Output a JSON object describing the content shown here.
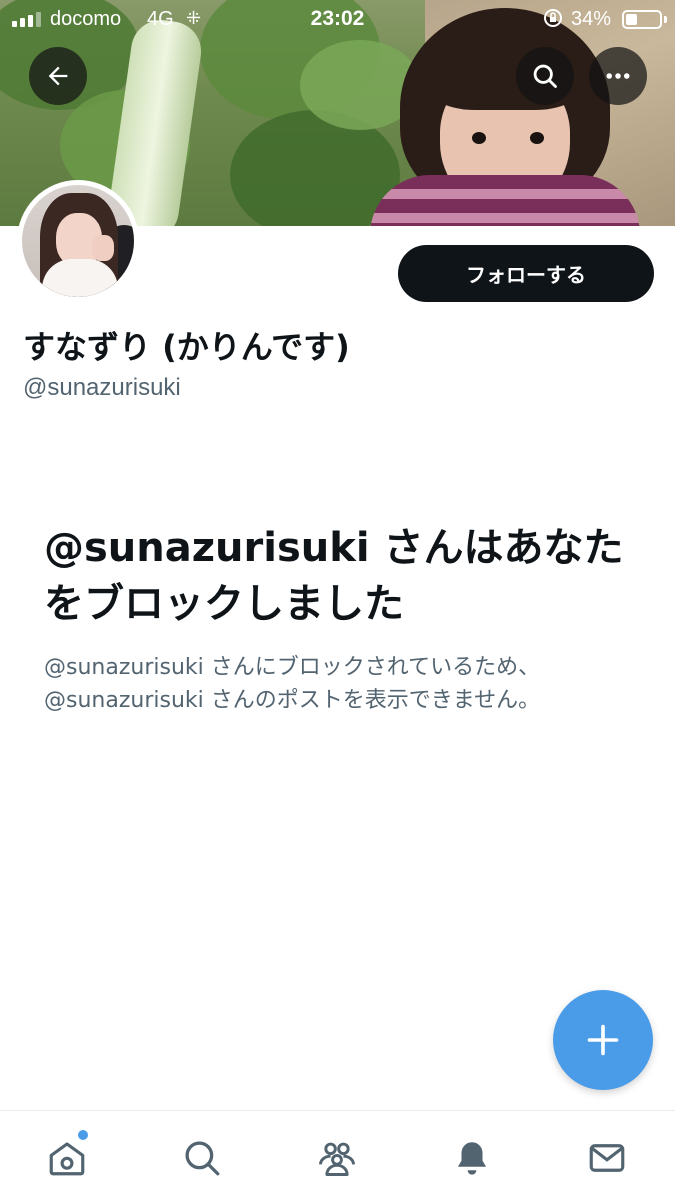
{
  "status_bar": {
    "carrier": "docomo",
    "network": "4G",
    "time": "23:02",
    "battery_percent": "34%",
    "battery_level": 0.34
  },
  "header": {
    "back_icon": "back-arrow-icon",
    "search_icon": "search-icon",
    "more_icon": "more-icon"
  },
  "profile": {
    "display_name": "すなずり (かりんです)",
    "handle": "@sunazurisuki",
    "follow_label": "フォローする"
  },
  "blocked": {
    "title": "@sunazurisuki さんはあなたをブロックしました",
    "description_line1": "@sunazurisuki さんにブロックされているため、",
    "description_line2": "@sunazurisuki さんのポストを表示できません。"
  },
  "fab": {
    "icon": "plus-icon"
  },
  "bottom_nav": {
    "items": [
      "home-icon",
      "search-icon",
      "communities-icon",
      "notifications-icon",
      "messages-icon"
    ]
  },
  "colors": {
    "accent": "#4a9be8",
    "text_primary": "#0f1419",
    "text_secondary": "#536471"
  }
}
